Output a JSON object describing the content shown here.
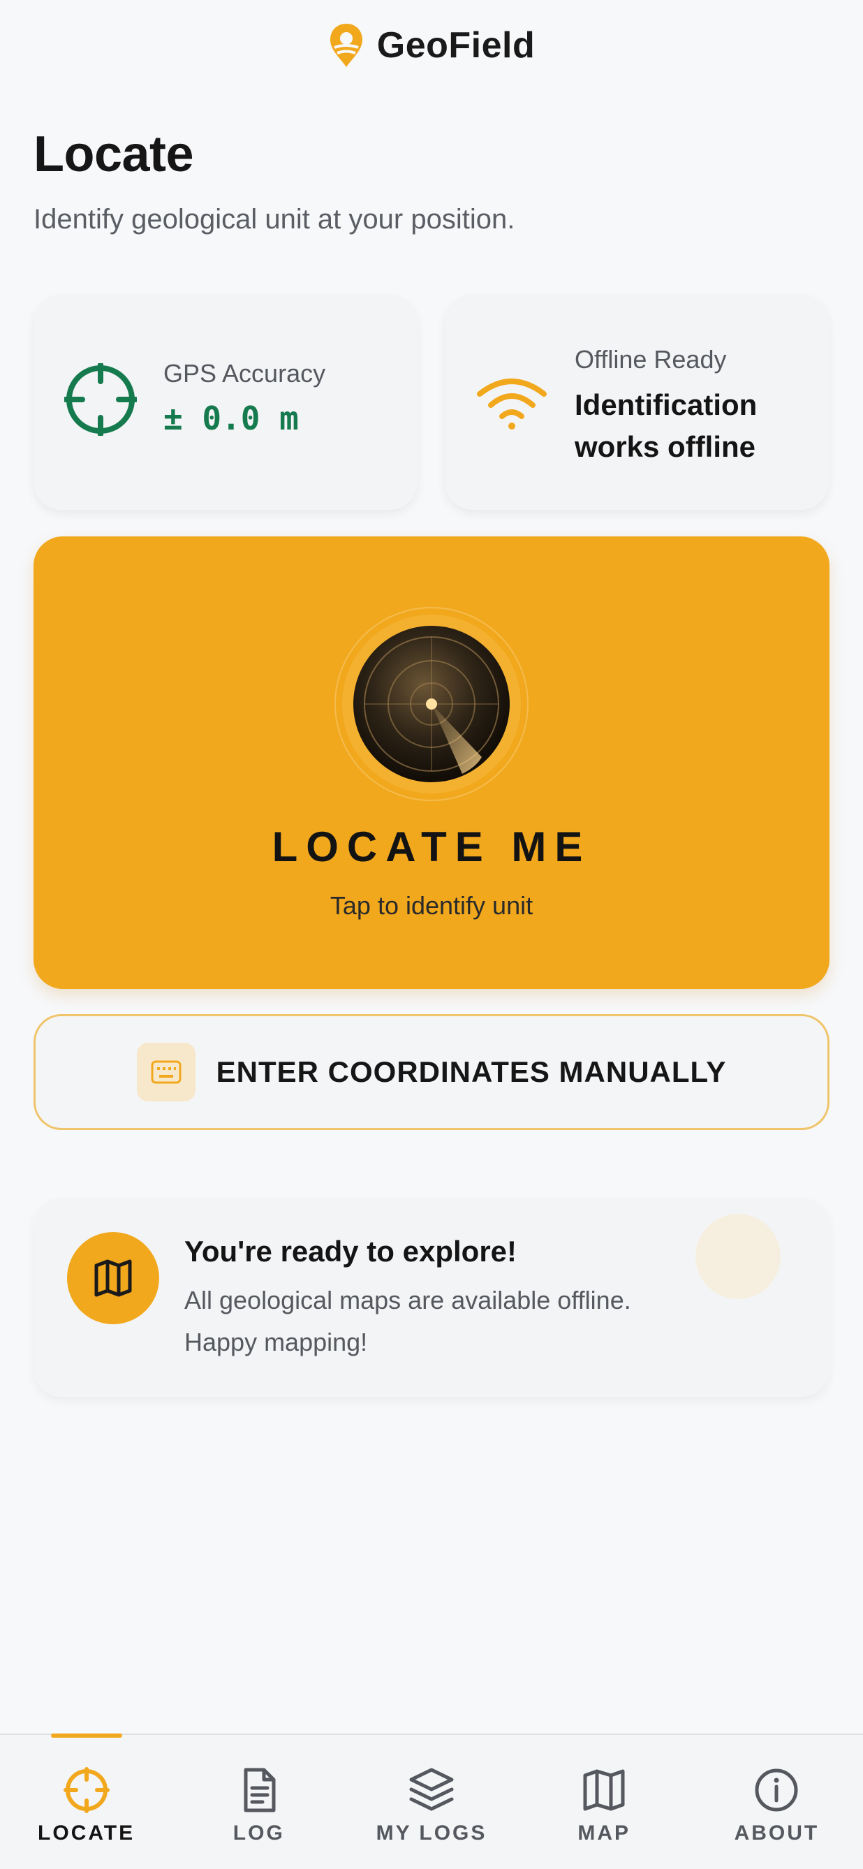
{
  "app": {
    "title": "GeoField"
  },
  "page": {
    "title": "Locate",
    "subtitle": "Identify geological unit at your position."
  },
  "status": {
    "gps": {
      "label": "GPS Accuracy",
      "value": "± 0.0 m",
      "icon": "crosshair-icon"
    },
    "offline": {
      "label": "Offline Ready",
      "value": "Identification works offline",
      "icon": "wifi-icon"
    }
  },
  "locate": {
    "label": "LOCATE ME",
    "hint": "Tap to identify unit",
    "icon": "radar-icon"
  },
  "manual": {
    "label": "ENTER COORDINATES MANUALLY",
    "icon": "keyboard-icon"
  },
  "ready": {
    "title": "You're ready to explore!",
    "text": "All geological maps are available offline. Happy mapping!",
    "icon": "map-icon"
  },
  "nav": {
    "items": [
      {
        "label": "LOCATE",
        "icon": "crosshair-icon",
        "active": true
      },
      {
        "label": "LOG",
        "icon": "document-icon",
        "active": false
      },
      {
        "label": "MY LOGS",
        "icon": "layers-icon",
        "active": false
      },
      {
        "label": "MAP",
        "icon": "map-icon",
        "active": false
      },
      {
        "label": "ABOUT",
        "icon": "info-icon",
        "active": false
      }
    ]
  },
  "colors": {
    "accent": "#f2a81d",
    "gps_green": "#157a4e",
    "background": "#f7f8fa",
    "card": "#f3f4f6"
  }
}
